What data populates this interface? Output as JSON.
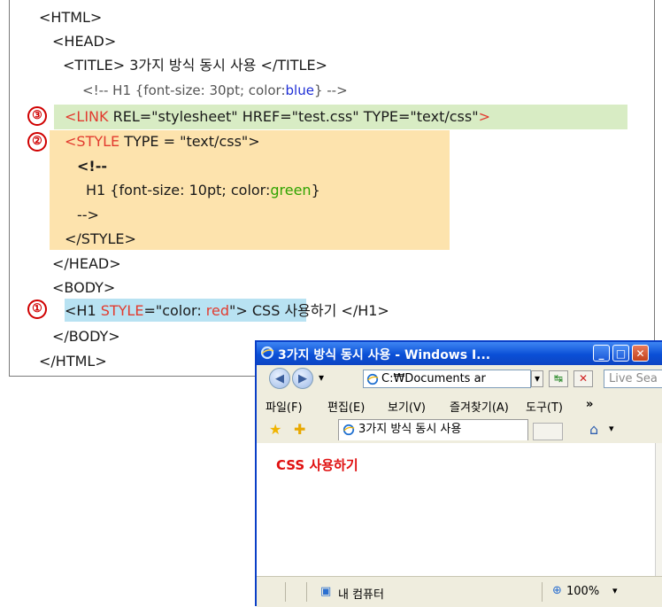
{
  "code": {
    "l1": "<HTML>",
    "l2": "<HEAD>",
    "l3": "<TITLE> 3가지 방식 동시 사용 </TITLE>",
    "l4": "<!-- H1 {font-size: 30pt; color:",
    "l4_blue": "blue",
    "l4_end": "} -->",
    "l5_red": "<LINK",
    "l5_mid": " REL=\"stylesheet\" HREF=\"test.css\" TYPE=\"text/css\"",
    "l5_close": ">",
    "l6_red": "<STYLE",
    "l6_rest": " TYPE = \"text/css\">",
    "l7": "<!--",
    "l8": "H1 {font-size: 10pt; color:",
    "l8_green": "green",
    "l8_end": "}",
    "l9": "-->",
    "l10": "</STYLE>",
    "l11": "</HEAD>",
    "l12": "<BODY>",
    "l13_a": "<H1 ",
    "l13_style": "STYLE",
    "l13_b": "=\"color: ",
    "l13_red": "red",
    "l13_c": "\">",
    "l13_text": " CSS 사용하기 </H1>",
    "l14": "</BODY>",
    "l15": "</HTML>",
    "markers": [
      "③",
      "②",
      "①"
    ]
  },
  "browser": {
    "title": "3가지 방식 동시 사용 - Windows I...",
    "address": "C:₩Documents ar",
    "search_placeholder": "Live Sea",
    "menus": [
      "파일(F)",
      "편집(E)",
      "보기(V)",
      "즐겨찾기(A)",
      "도구(T)",
      "»"
    ],
    "tab_label": "3가지 방식 동시 사용",
    "content_h1": "CSS 사용하기",
    "status_zone": "내 컴퓨터",
    "zoom": "100%"
  },
  "colors": {
    "green_highlight": "#d8ecc4",
    "orange_highlight": "#fde3ad",
    "blue_highlight": "#b8e2f2",
    "marker_red": "#d00000"
  }
}
